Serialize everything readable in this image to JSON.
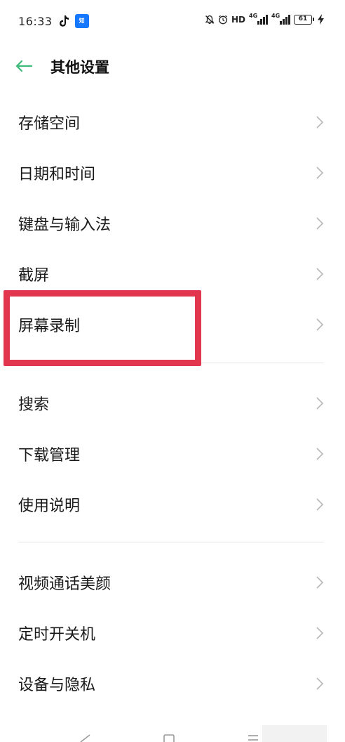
{
  "status_bar": {
    "time": "16:33",
    "hd_label": "HD",
    "network_1": "4G",
    "network_2": "4G",
    "battery_level": "61"
  },
  "header": {
    "title": "其他设置",
    "back_icon": "arrow-left-icon",
    "accent_color": "#3dbb78"
  },
  "sections": [
    {
      "items": [
        {
          "label": "存储空间"
        },
        {
          "label": "日期和时间"
        },
        {
          "label": "键盘与输入法"
        },
        {
          "label": "截屏"
        },
        {
          "label": "屏幕录制"
        }
      ]
    },
    {
      "items": [
        {
          "label": "搜索"
        },
        {
          "label": "下载管理"
        },
        {
          "label": "使用说明"
        }
      ]
    },
    {
      "items": [
        {
          "label": "视频通话美颜"
        },
        {
          "label": "定时开关机"
        },
        {
          "label": "设备与隐私"
        }
      ]
    }
  ],
  "highlight": {
    "target": "屏幕录制",
    "color": "#e2364e"
  },
  "nav_bar": {
    "icons": [
      "back-triangle-icon",
      "home-square-icon",
      "menu-lines-icon"
    ]
  }
}
